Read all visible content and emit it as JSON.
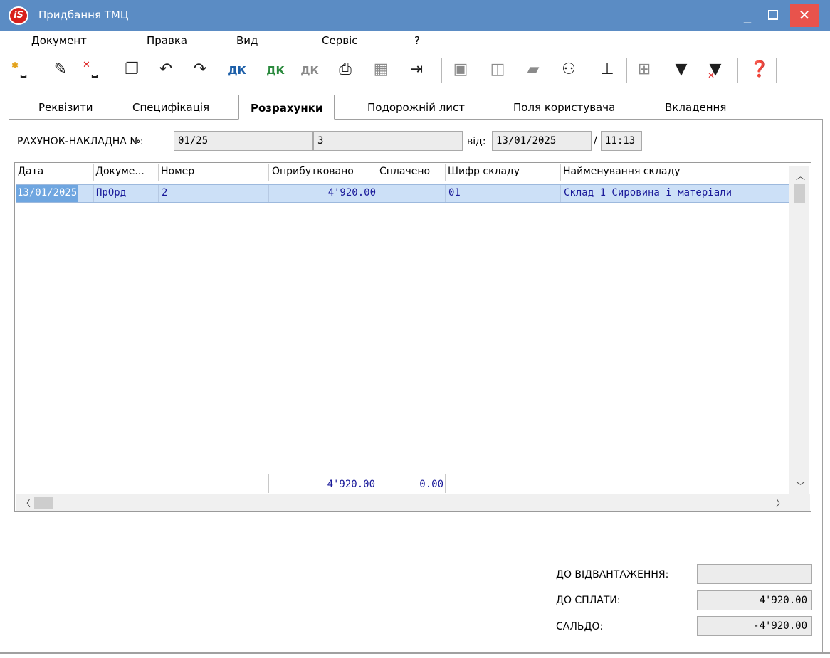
{
  "window": {
    "title": "Придбання ТМЦ",
    "logo_text": "iS"
  },
  "menu": [
    "Документ",
    "Правка",
    "Вид",
    "Сервіс",
    "?"
  ],
  "tabs": [
    "Реквізити",
    "Специфікація",
    "Розрахунки",
    "Подорожній лист",
    "Поля користувача",
    "Вкладення"
  ],
  "active_tab": "Розрахунки",
  "invoice": {
    "label": "РАХУНОК-НАКЛАДНА №:",
    "number": "01/25",
    "extra": "3",
    "date_label": "від:",
    "date": "13/01/2025",
    "time_sep": "/",
    "time": "11:13"
  },
  "grid": {
    "columns": [
      "Дата",
      "Докуме...",
      "Номер",
      "Оприбутковано",
      "Сплачено",
      "Шифр складу",
      "Найменування складу"
    ],
    "rows": [
      {
        "date": "13/01/2025",
        "doc": "ПрОрд",
        "number": "2",
        "received": "4'920.00",
        "paid": "",
        "store_code": "01",
        "store_name": "Склад 1 Сировина і матеріали"
      }
    ],
    "totals": {
      "received": "4'920.00",
      "paid": "0.00"
    }
  },
  "summary": {
    "shipment_label": "ДО ВІДВАНТАЖЕННЯ:",
    "shipment_value": "",
    "pay_label": "ДО СПЛАТИ:",
    "pay_value": "4'920.00",
    "balance_label": "САЛЬДО:",
    "balance_value": "-4'920.00"
  }
}
